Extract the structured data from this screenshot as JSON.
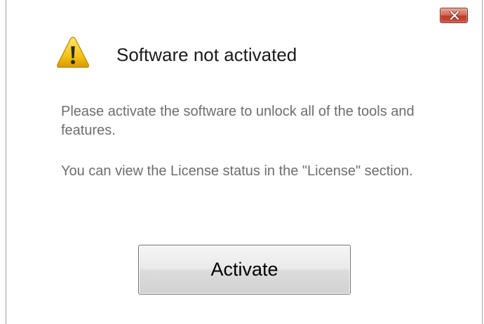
{
  "dialog": {
    "title": "Software not activated",
    "message_1": "Please activate the software to unlock all of the tools and features.",
    "message_2": "You can view the License status in the \"License\" section.",
    "activate_label": "Activate",
    "icon": "warning-icon",
    "close_icon": "close-icon"
  },
  "colors": {
    "close_button": "#c8543f",
    "warning_yellow": "#f5c518",
    "message_text": "#6d6d6d"
  }
}
